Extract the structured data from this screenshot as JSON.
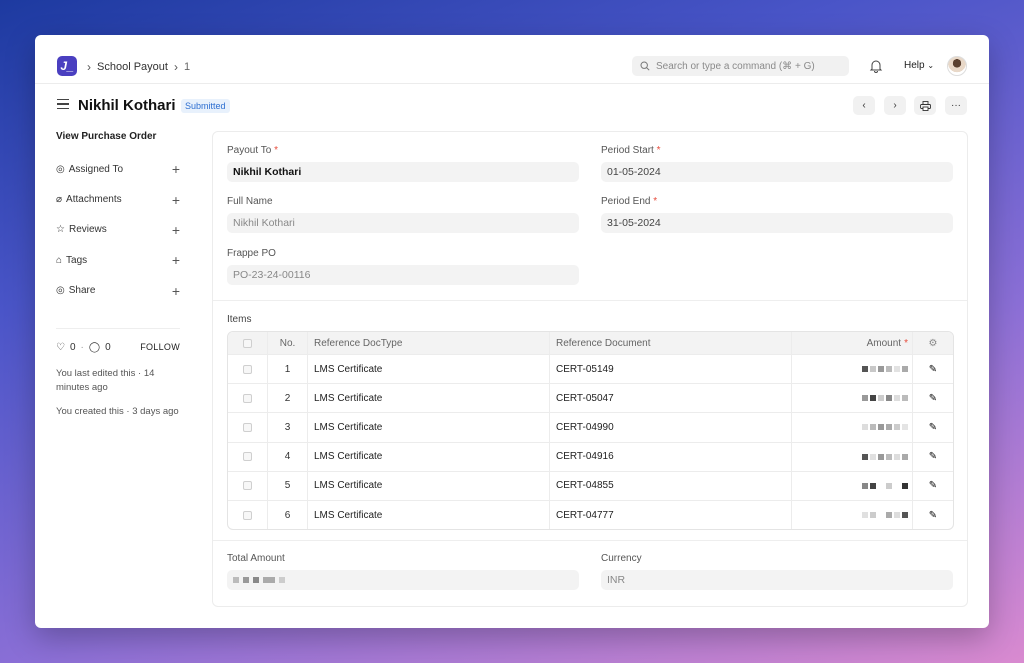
{
  "nav": {
    "logo_text": "J_",
    "breadcrumbs": [
      "School Payout",
      "1"
    ],
    "search_placeholder": "Search or type a command (⌘ + G)",
    "help_label": "Help"
  },
  "page": {
    "title": "Nikhil Kothari",
    "status": "Submitted"
  },
  "sidebar": {
    "primary_link": "View Purchase Order",
    "items": [
      {
        "label": "Assigned To",
        "icon": "user-circle-icon"
      },
      {
        "label": "Attachments",
        "icon": "paperclip-icon"
      },
      {
        "label": "Reviews",
        "icon": "star-icon"
      },
      {
        "label": "Tags",
        "icon": "tag-icon"
      },
      {
        "label": "Share",
        "icon": "share-user-icon"
      }
    ],
    "likes": "0",
    "comments": "0",
    "follow_label": "FOLLOW",
    "last_edited": "You last edited this · 14 minutes ago",
    "created": "You created this · 3 days ago"
  },
  "form": {
    "payout_to": {
      "label": "Payout To",
      "value": "Nikhil Kothari"
    },
    "full_name": {
      "label": "Full Name",
      "value": "Nikhil Kothari"
    },
    "frappe_po": {
      "label": "Frappe PO",
      "value": "PO-23-24-00116"
    },
    "period_start": {
      "label": "Period Start",
      "value": "01-05-2024"
    },
    "period_end": {
      "label": "Period End",
      "value": "31-05-2024"
    },
    "total_amount": {
      "label": "Total Amount"
    },
    "currency": {
      "label": "Currency",
      "value": "INR"
    }
  },
  "items": {
    "label": "Items",
    "columns": [
      "No.",
      "Reference DocType",
      "Reference Document",
      "Amount"
    ],
    "rows": [
      {
        "no": "1",
        "doctype": "LMS Certificate",
        "document": "CERT-05149"
      },
      {
        "no": "2",
        "doctype": "LMS Certificate",
        "document": "CERT-05047"
      },
      {
        "no": "3",
        "doctype": "LMS Certificate",
        "document": "CERT-04990"
      },
      {
        "no": "4",
        "doctype": "LMS Certificate",
        "document": "CERT-04916"
      },
      {
        "no": "5",
        "doctype": "LMS Certificate",
        "document": "CERT-04855"
      },
      {
        "no": "6",
        "doctype": "LMS Certificate",
        "document": "CERT-04777"
      }
    ]
  },
  "colors": {
    "accent": "#4a3fc0",
    "badge": "#2d6fd1",
    "required": "#e74c3c"
  }
}
